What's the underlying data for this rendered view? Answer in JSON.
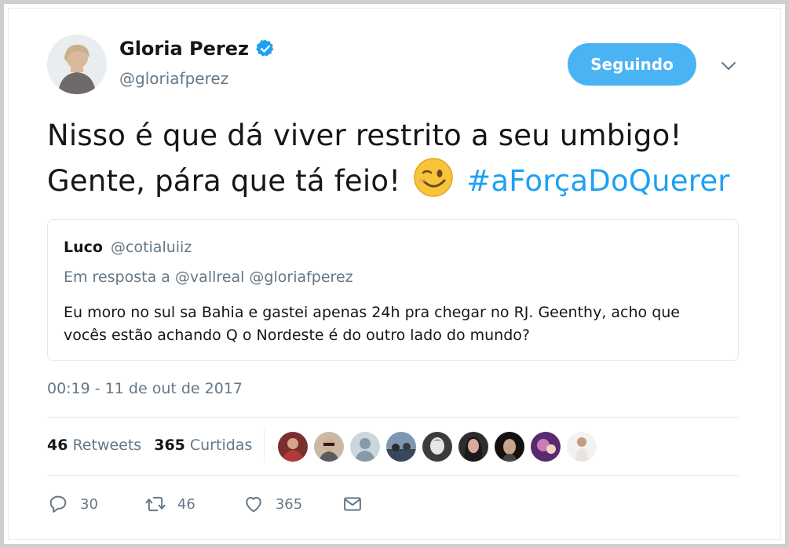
{
  "author": {
    "name": "Gloria Perez",
    "handle": "@gloriafperez",
    "verified_icon": "verified-badge-icon"
  },
  "follow_button": {
    "label": "Seguindo"
  },
  "tweet": {
    "line1": "Nisso é que dá viver restrito a seu umbigo!",
    "line2": "Gente, pára que tá feio!",
    "emoji": "winking-face-emoji",
    "hashtag": "#aForçaDoQuerer"
  },
  "quoted_tweet": {
    "name": "Luco",
    "handle": "@cotialuiiz",
    "reply_line": "Em resposta a @vallreal @gloriafperez",
    "text_line1": "Eu moro no sul sa Bahia e gastei apenas 24h pra chegar no RJ. Geenthy, acho que",
    "text_line2": "vocês estão achando Q o Nordeste é do outro lado do mundo?"
  },
  "timestamp": "00:19 - 11 de out de 2017",
  "stats": {
    "retweets_count": "46",
    "retweets_label": "Retweets",
    "likes_count": "365",
    "likes_label": "Curtidas"
  },
  "likers": [
    {
      "name": "liker-1"
    },
    {
      "name": "liker-2"
    },
    {
      "name": "liker-3"
    },
    {
      "name": "liker-4"
    },
    {
      "name": "liker-5"
    },
    {
      "name": "liker-6"
    },
    {
      "name": "liker-7"
    },
    {
      "name": "liker-8"
    },
    {
      "name": "liker-9"
    }
  ],
  "actions": {
    "reply_count": "30",
    "retweet_count": "46",
    "like_count": "365"
  },
  "colors": {
    "accent": "#1da1f2",
    "button": "#4ab3f4",
    "muted": "#657786"
  }
}
